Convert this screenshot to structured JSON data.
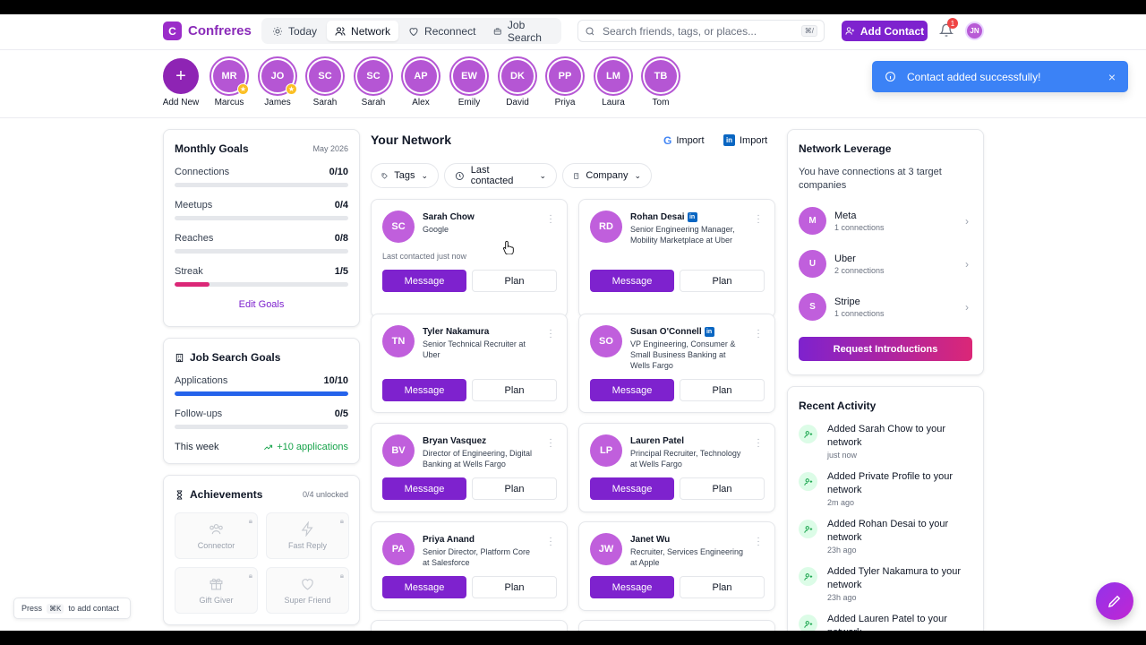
{
  "app": {
    "name": "Confreres",
    "logo_letter": "C",
    "brand_color": "#7e22ce"
  },
  "nav": {
    "tabs": [
      {
        "label": "Today",
        "icon": "sun-icon"
      },
      {
        "label": "Network",
        "icon": "people-icon"
      },
      {
        "label": "Reconnect",
        "icon": "heart-icon"
      },
      {
        "label": "Job Search",
        "icon": "briefcase-icon"
      }
    ],
    "active": "Network"
  },
  "search": {
    "placeholder": "Search friends, tags, or places...",
    "shortcut": "⌘/"
  },
  "header": {
    "add_contact": "Add Contact",
    "notifications": "1",
    "user_initials": "JN"
  },
  "stories": [
    {
      "initials": "+",
      "label": "Add New",
      "starred": false
    },
    {
      "initials": "MR",
      "label": "Marcus",
      "starred": true
    },
    {
      "initials": "JO",
      "label": "James",
      "starred": true
    },
    {
      "initials": "SC",
      "label": "Sarah",
      "starred": false
    },
    {
      "initials": "SC",
      "label": "Sarah",
      "starred": false
    },
    {
      "initials": "AP",
      "label": "Alex",
      "starred": false
    },
    {
      "initials": "EW",
      "label": "Emily",
      "starred": false
    },
    {
      "initials": "DK",
      "label": "David",
      "starred": false
    },
    {
      "initials": "PP",
      "label": "Priya",
      "starred": false
    },
    {
      "initials": "LM",
      "label": "Laura",
      "starred": false
    },
    {
      "initials": "TB",
      "label": "Tom",
      "starred": false
    }
  ],
  "toast": {
    "message": "Contact added successfully!",
    "close": "×"
  },
  "goals": {
    "title": "Monthly Goals",
    "period": "May 2026",
    "items": [
      {
        "label": "Connections",
        "value": "0/10",
        "fraction": 0
      },
      {
        "label": "Meetups",
        "value": "0/4",
        "fraction": 0
      },
      {
        "label": "Reaches",
        "value": "0/8",
        "fraction": 0
      },
      {
        "label": "Streak",
        "value": "1/5",
        "fraction": 0.2,
        "color": "#db2777"
      }
    ],
    "edit": "Edit Goals"
  },
  "job_goals": {
    "title": "Job Search Goals",
    "items": [
      {
        "label": "Applications",
        "value": "10/10",
        "fraction": 1,
        "color": "#2563eb"
      },
      {
        "label": "Follow-ups",
        "value": "0/5",
        "fraction": 0
      }
    ],
    "week_label": "This week",
    "week_value": "+10 applications"
  },
  "achievements": {
    "title": "Achievements",
    "count": "0/4 unlocked",
    "badges": [
      {
        "label": "Connector",
        "icon": "people-icon"
      },
      {
        "label": "Fast Reply",
        "icon": "lightning-icon"
      },
      {
        "label": "Gift Giver",
        "icon": "gift-icon"
      },
      {
        "label": "Super Friend",
        "icon": "heart-icon"
      }
    ]
  },
  "network": {
    "title": "Your Network",
    "import_google": "Import",
    "import_linkedin": "Import",
    "filters": [
      "Tags",
      "Last contacted",
      "Company"
    ],
    "message_label": "Message",
    "plan_label": "Plan",
    "contacts": [
      {
        "initials": "SC",
        "name": "Sarah Chow",
        "linkedin": false,
        "sub": "Google",
        "last": "Last contacted just now"
      },
      {
        "initials": "RD",
        "name": "Rohan Desai",
        "linkedin": true,
        "sub": "Senior Engineering Manager, Mobility Marketplace at Uber",
        "last": ""
      },
      {
        "initials": "TN",
        "name": "Tyler Nakamura",
        "linkedin": false,
        "sub": "Senior Technical Recruiter at Uber",
        "last": ""
      },
      {
        "initials": "SO",
        "name": "Susan O'Connell",
        "linkedin": true,
        "sub": "VP Engineering, Consumer & Small Business Banking at Wells Fargo",
        "last": ""
      },
      {
        "initials": "BV",
        "name": "Bryan Vasquez",
        "linkedin": false,
        "sub": "Director of Engineering, Digital Banking at Wells Fargo",
        "last": ""
      },
      {
        "initials": "LP",
        "name": "Lauren Patel",
        "linkedin": false,
        "sub": "Principal Recruiter, Technology at Wells Fargo",
        "last": ""
      },
      {
        "initials": "PA",
        "name": "Priya Anand",
        "linkedin": false,
        "sub": "Senior Director, Platform Core at Salesforce",
        "last": ""
      },
      {
        "initials": "JW",
        "name": "Janet Wu",
        "linkedin": false,
        "sub": "Recruiter, Services Engineering at Apple",
        "last": ""
      }
    ]
  },
  "leverage": {
    "title": "Network Leverage",
    "desc": "You have connections at 3 target companies",
    "companies": [
      {
        "initial": "M",
        "name": "Meta",
        "count": "1 connections"
      },
      {
        "initial": "U",
        "name": "Uber",
        "count": "2 connections"
      },
      {
        "initial": "S",
        "name": "Stripe",
        "count": "1 connections"
      }
    ],
    "button": "Request Introductions"
  },
  "activity": {
    "title": "Recent Activity",
    "items": [
      {
        "text": "Added Sarah Chow to your network",
        "time": "just now"
      },
      {
        "text": "Added Private Profile to your network",
        "time": "2m ago"
      },
      {
        "text": "Added Rohan Desai to your network",
        "time": "23h ago"
      },
      {
        "text": "Added Tyler Nakamura to your network",
        "time": "23h ago"
      },
      {
        "text": "Added Lauren Patel to your network",
        "time": ""
      }
    ]
  },
  "hint": {
    "press": "Press",
    "key": "⌘K",
    "action": "to add contact"
  }
}
